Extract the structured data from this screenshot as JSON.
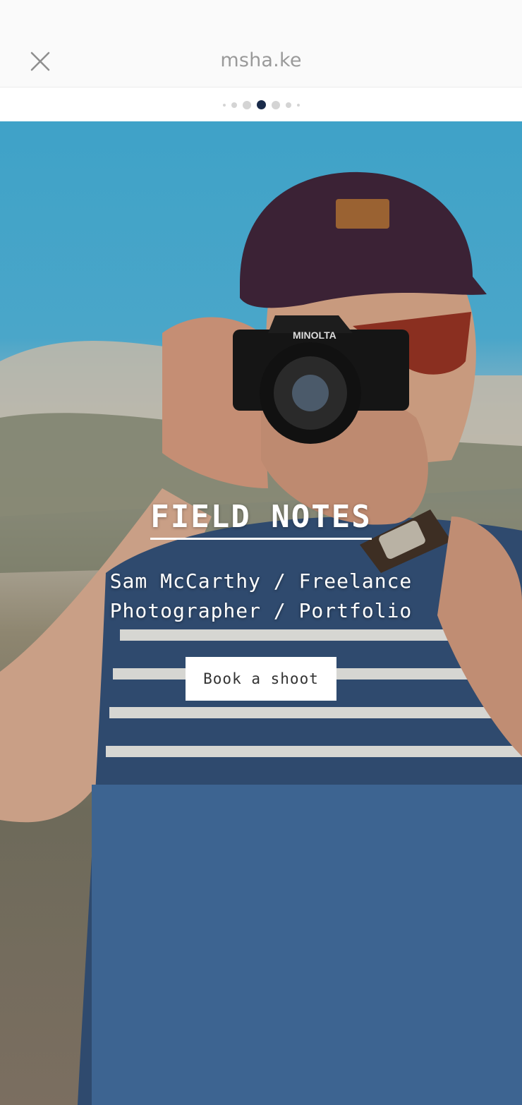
{
  "header": {
    "close_icon": "close-icon",
    "title": "msha.ke"
  },
  "pager": {
    "dot_count": 7,
    "active_index": 3
  },
  "hero": {
    "title": "FIELD NOTES",
    "subtitle": "Sam McCarthy / Freelance Photographer / Portfolio",
    "cta_label": "Book a shoot"
  },
  "colors": {
    "active_dot": "#1a2b4a",
    "inactive_dot": "#d4d4d4",
    "header_bg": "#fafafa",
    "title_text": "#9a9a9a"
  }
}
